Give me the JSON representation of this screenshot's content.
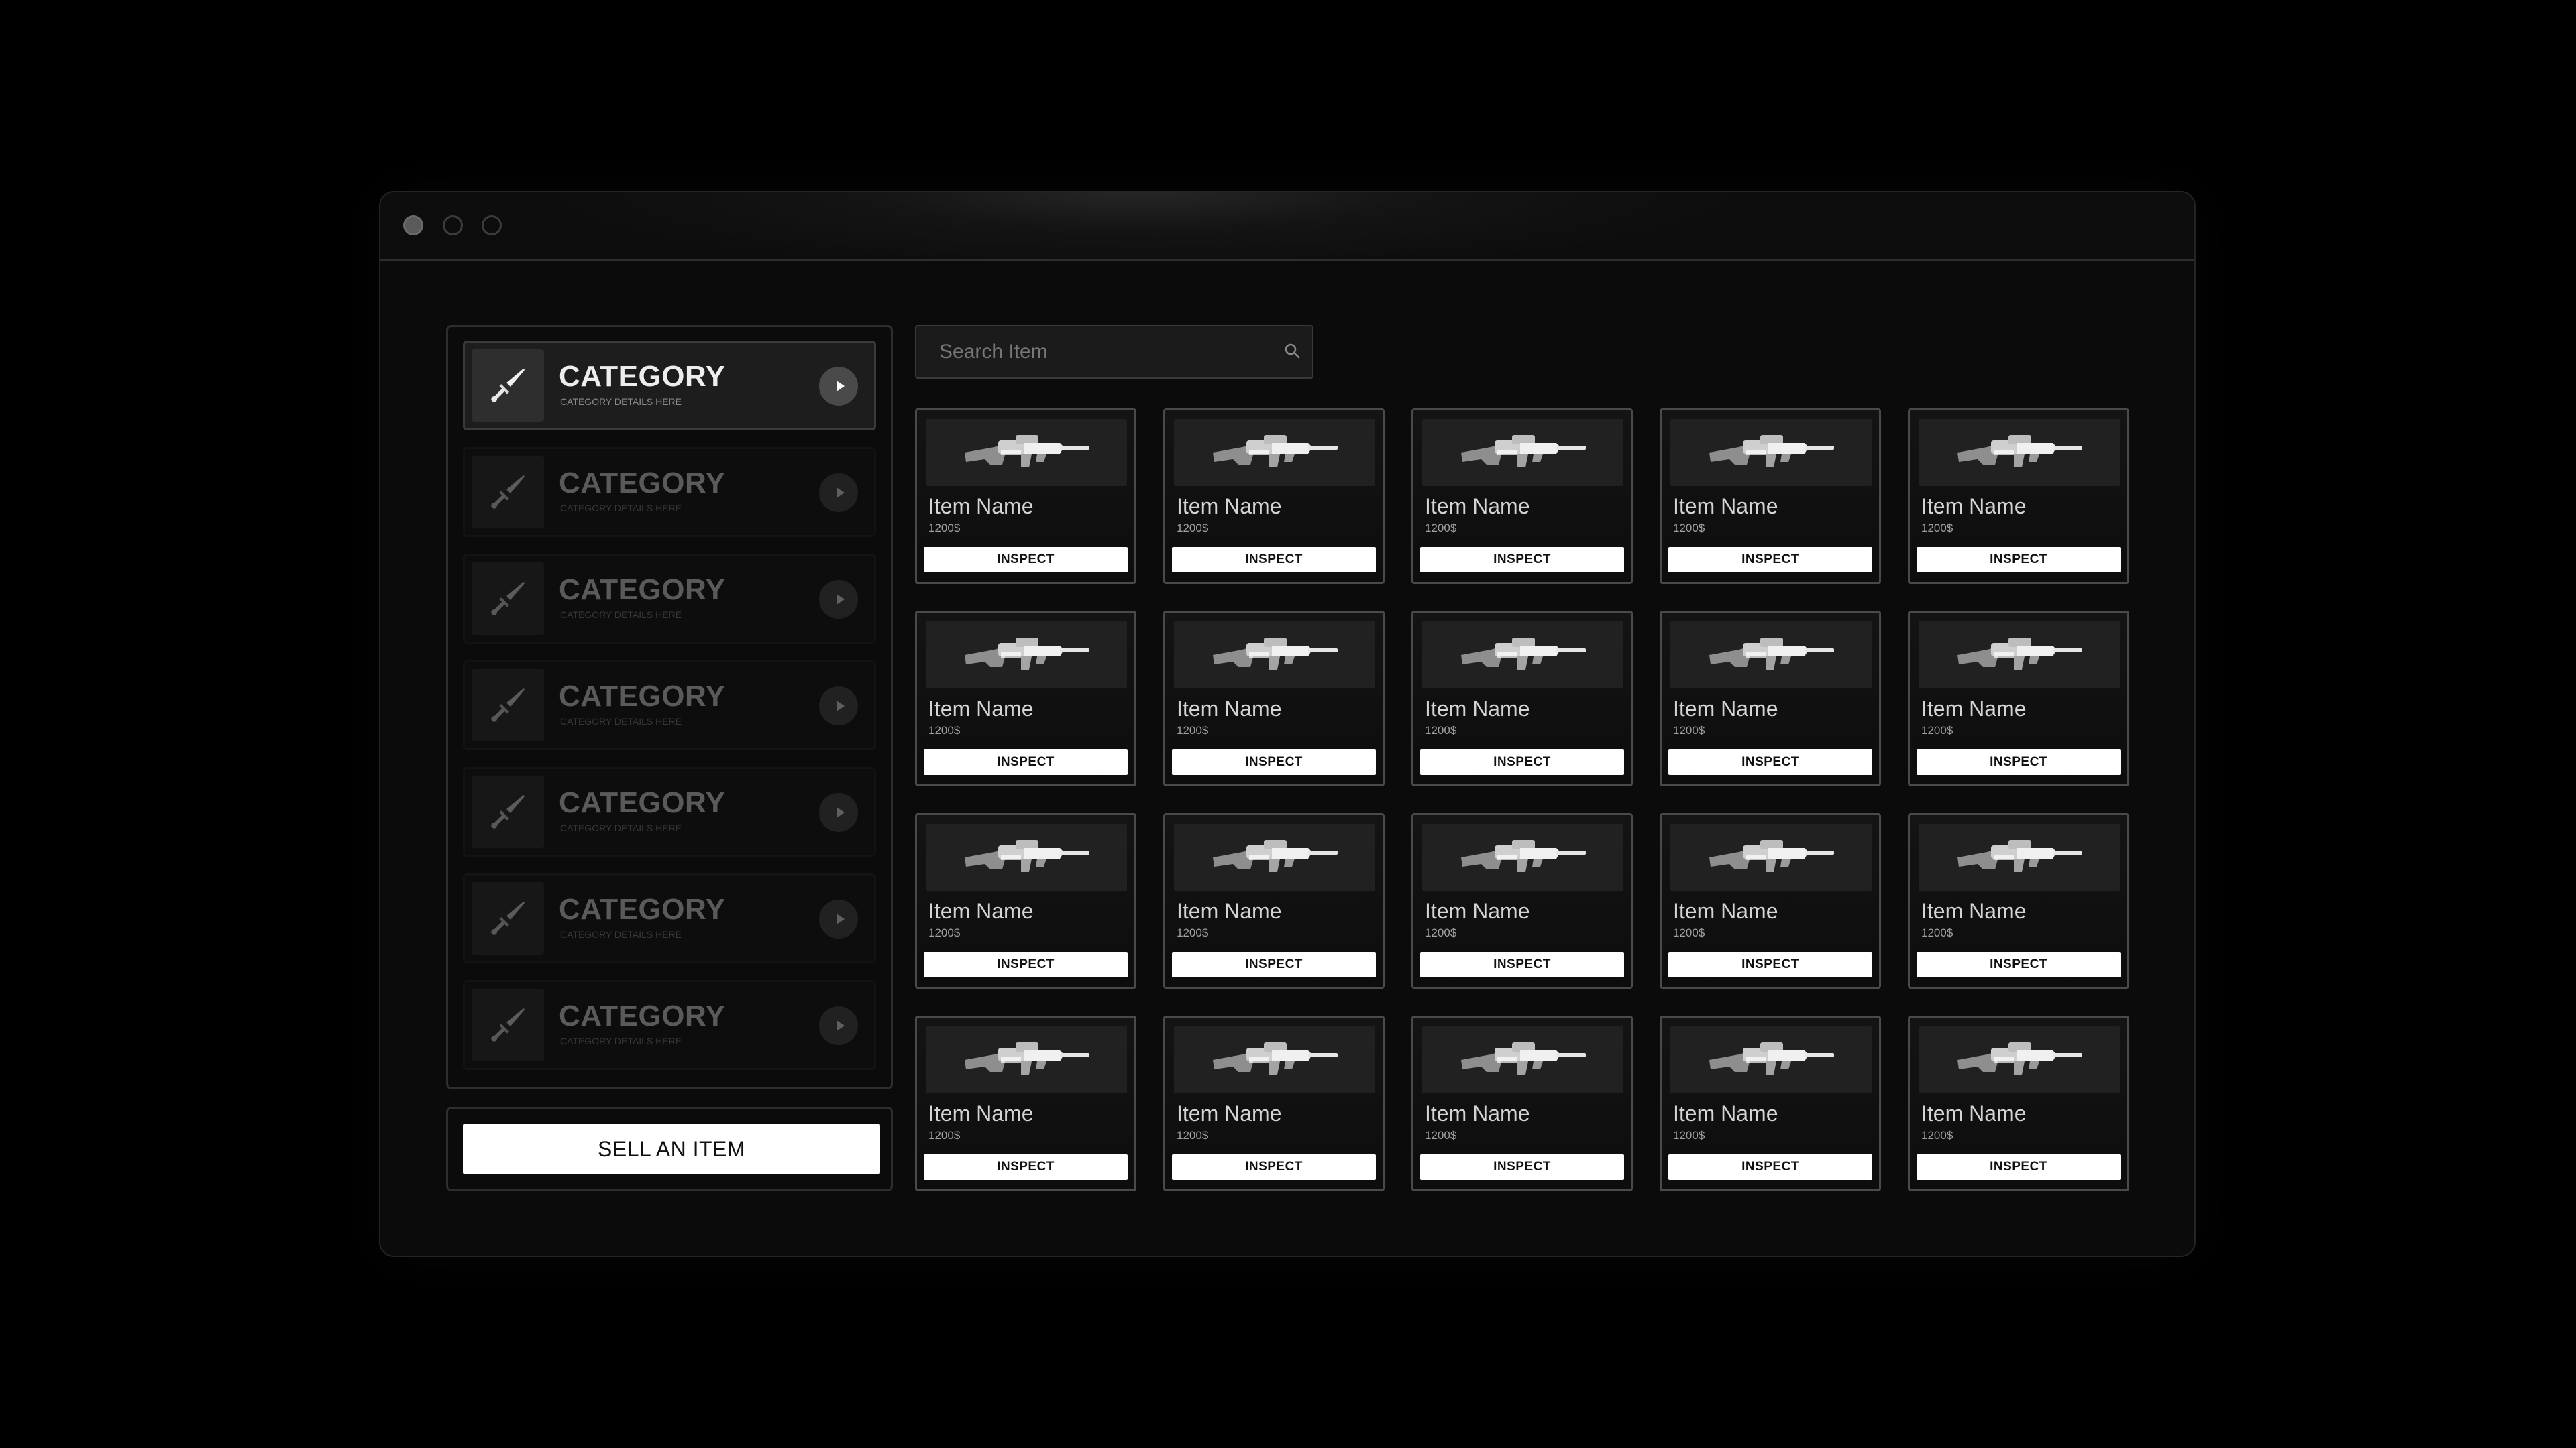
{
  "window": {
    "controls": [
      "close",
      "minimize",
      "maximize"
    ]
  },
  "sidebar": {
    "categories": [
      {
        "title": "CATEGORY",
        "subtitle": "CATEGORY DETAILS HERE",
        "icon": "sword-icon",
        "active": true
      },
      {
        "title": "CATEGORY",
        "subtitle": "CATEGORY DETAILS HERE",
        "icon": "sword-icon",
        "active": false
      },
      {
        "title": "CATEGORY",
        "subtitle": "CATEGORY DETAILS HERE",
        "icon": "sword-icon",
        "active": false
      },
      {
        "title": "CATEGORY",
        "subtitle": "CATEGORY DETAILS HERE",
        "icon": "sword-icon",
        "active": false
      },
      {
        "title": "CATEGORY",
        "subtitle": "CATEGORY DETAILS HERE",
        "icon": "sword-icon",
        "active": false
      },
      {
        "title": "CATEGORY",
        "subtitle": "CATEGORY DETAILS HERE",
        "icon": "sword-icon",
        "active": false
      },
      {
        "title": "CATEGORY",
        "subtitle": "CATEGORY DETAILS HERE",
        "icon": "sword-icon",
        "active": false
      }
    ],
    "sell_label": "SELL AN ITEM"
  },
  "search": {
    "placeholder": "Search Item",
    "value": ""
  },
  "items": [
    {
      "name": "Item Name",
      "price": "1200$",
      "action": "INSPECT"
    },
    {
      "name": "Item Name",
      "price": "1200$",
      "action": "INSPECT"
    },
    {
      "name": "Item Name",
      "price": "1200$",
      "action": "INSPECT"
    },
    {
      "name": "Item Name",
      "price": "1200$",
      "action": "INSPECT"
    },
    {
      "name": "Item Name",
      "price": "1200$",
      "action": "INSPECT"
    },
    {
      "name": "Item Name",
      "price": "1200$",
      "action": "INSPECT"
    },
    {
      "name": "Item Name",
      "price": "1200$",
      "action": "INSPECT"
    },
    {
      "name": "Item Name",
      "price": "1200$",
      "action": "INSPECT"
    },
    {
      "name": "Item Name",
      "price": "1200$",
      "action": "INSPECT"
    },
    {
      "name": "Item Name",
      "price": "1200$",
      "action": "INSPECT"
    },
    {
      "name": "Item Name",
      "price": "1200$",
      "action": "INSPECT"
    },
    {
      "name": "Item Name",
      "price": "1200$",
      "action": "INSPECT"
    },
    {
      "name": "Item Name",
      "price": "1200$",
      "action": "INSPECT"
    },
    {
      "name": "Item Name",
      "price": "1200$",
      "action": "INSPECT"
    },
    {
      "name": "Item Name",
      "price": "1200$",
      "action": "INSPECT"
    },
    {
      "name": "Item Name",
      "price": "1200$",
      "action": "INSPECT"
    },
    {
      "name": "Item Name",
      "price": "1200$",
      "action": "INSPECT"
    },
    {
      "name": "Item Name",
      "price": "1200$",
      "action": "INSPECT"
    },
    {
      "name": "Item Name",
      "price": "1200$",
      "action": "INSPECT"
    },
    {
      "name": "Item Name",
      "price": "1200$",
      "action": "INSPECT"
    }
  ],
  "colors": {
    "background": "#000000",
    "window": "#0b0b0b",
    "panel_border": "#2e2e2e",
    "button": "#ffffff",
    "text": "#d4d4d4"
  }
}
